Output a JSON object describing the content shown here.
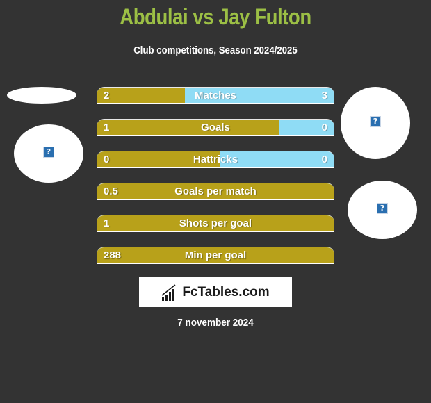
{
  "header": {
    "title": "Abdulai vs Jay Fulton",
    "subtitle": "Club competitions, Season 2024/2025"
  },
  "players": {
    "left": {
      "image_icon": "broken-image-icon",
      "icon_glyph": "?"
    },
    "right": {
      "image_icon": "broken-image-icon",
      "icon_glyph": "?"
    }
  },
  "stats": [
    {
      "label": "Matches",
      "left": "2",
      "right": "3",
      "left_fill_pct": 37
    },
    {
      "label": "Goals",
      "left": "1",
      "right": "0",
      "left_fill_pct": 77
    },
    {
      "label": "Hattricks",
      "left": "0",
      "right": "0",
      "left_fill_pct": 52
    },
    {
      "label": "Goals per match",
      "left": "0.5",
      "right": "",
      "left_fill_pct": 100
    },
    {
      "label": "Shots per goal",
      "left": "1",
      "right": "",
      "left_fill_pct": 100
    },
    {
      "label": "Min per goal",
      "left": "288",
      "right": "",
      "left_fill_pct": 100
    }
  ],
  "logo": {
    "text": "FcTables.com",
    "icon": "bar-chart-icon"
  },
  "footer": {
    "date": "7 november 2024"
  },
  "colors": {
    "background": "#333333",
    "title": "#9cbf45",
    "left_fill": "#b8a11a",
    "right_fill": "#8fdcf5"
  }
}
